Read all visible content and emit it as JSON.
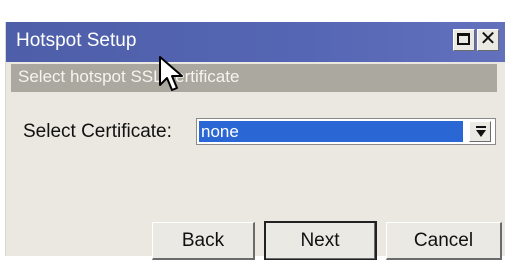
{
  "window": {
    "title": "Hotspot Setup",
    "subtitle": "Select hotspot SSL certificate"
  },
  "form": {
    "certificate_label": "Select Certificate:",
    "certificate_value": "none"
  },
  "buttons": {
    "back": "Back",
    "next": "Next",
    "cancel": "Cancel"
  },
  "colors": {
    "titlebar": "#5566b4",
    "subtitle_bar": "#aba8a0",
    "selection": "#2a67d4",
    "window_bg": "#eae8e0"
  },
  "icons": {
    "maximize": "maximize-icon",
    "close": "close-icon",
    "dropdown": "dropdown-arrow-icon",
    "cursor": "mouse-cursor-icon"
  }
}
